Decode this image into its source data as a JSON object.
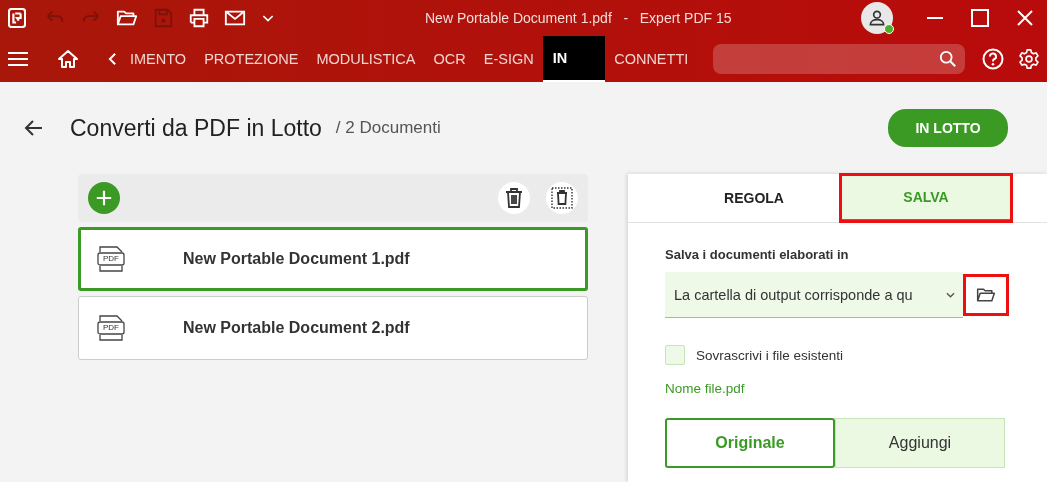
{
  "window": {
    "title": "New Portable Document 1.pdf   -   Expert PDF 15"
  },
  "quick_access": [
    {
      "kind": "open",
      "disabled": false
    },
    {
      "kind": "save",
      "disabled": true
    },
    {
      "kind": "print",
      "disabled": false
    },
    {
      "kind": "mail",
      "disabled": false
    }
  ],
  "history": {
    "undo_disabled": true,
    "redo_disabled": true
  },
  "user": {
    "online": true
  },
  "ribbon_tabs": [
    {
      "label": "IMENTO",
      "selected": false
    },
    {
      "label": "PROTEZIONE",
      "selected": false
    },
    {
      "label": "MODULISTICA",
      "selected": false
    },
    {
      "label": "OCR",
      "selected": false
    },
    {
      "label": "E-SIGN",
      "selected": false
    },
    {
      "label": "IN",
      "selected": true
    },
    {
      "label": "CONNETTI",
      "selected": false
    }
  ],
  "page": {
    "title": "Converti da PDF in Lotto",
    "subtitle": "/ 2 Documenti",
    "action": "IN LOTTO"
  },
  "files": [
    {
      "name": "New Portable Document 1.pdf",
      "icon_label": "PDF",
      "selected": true
    },
    {
      "name": "New Portable Document 2.pdf",
      "icon_label": "PDF",
      "selected": false
    }
  ],
  "panel": {
    "tabs": [
      {
        "label": "REGOLA",
        "selected": false,
        "highlighted": false
      },
      {
        "label": "SALVA",
        "selected": true,
        "highlighted": true
      }
    ],
    "output_label": "Salva i documenti elaborati in",
    "output_value": "La cartella di output corrisponde a qu",
    "browse_highlighted": true,
    "overwrite": {
      "label": "Sovrascrivi i file esistenti",
      "checked": false
    },
    "filename_link": "Nome file.pdf",
    "modes": [
      {
        "label": "Originale",
        "selected": true
      },
      {
        "label": "Aggiungi",
        "selected": false
      }
    ]
  }
}
